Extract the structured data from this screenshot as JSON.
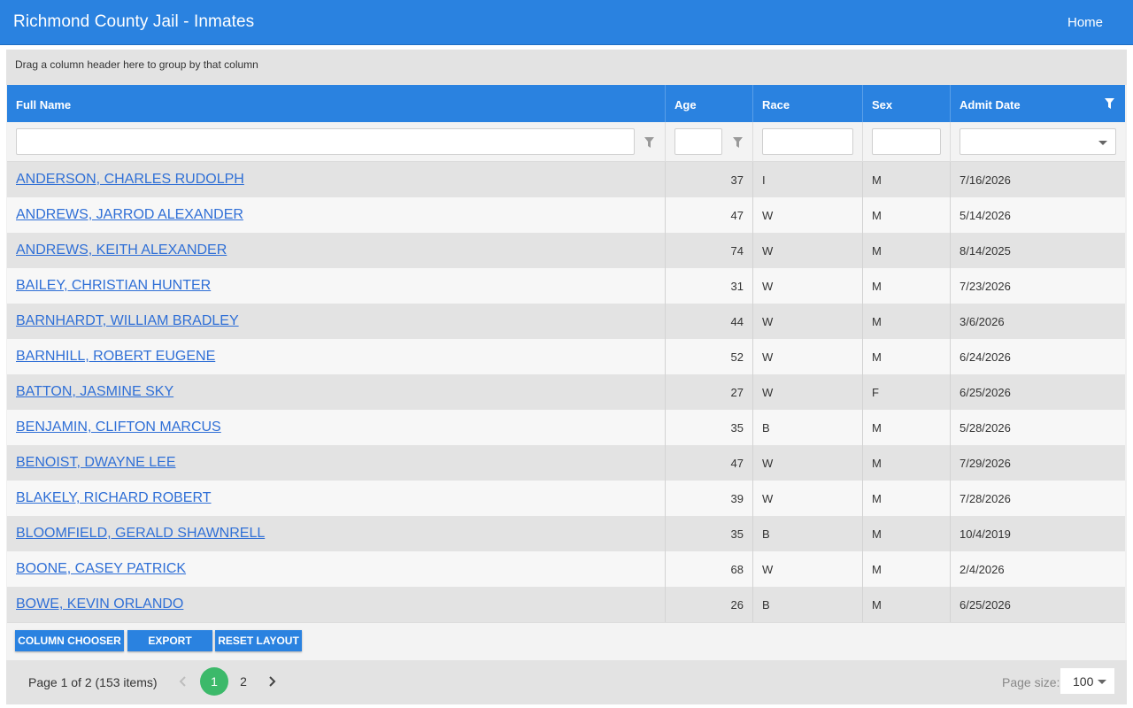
{
  "app": {
    "title": "Richmond County Jail - Inmates",
    "home_label": "Home"
  },
  "grid": {
    "group_panel_text": "Drag a column header here to group by that column",
    "columns": [
      "Full Name",
      "Age",
      "Race",
      "Sex",
      "Admit Date"
    ],
    "rows": [
      {
        "name": "ANDERSON, CHARLES RUDOLPH",
        "age": "37",
        "race": "I",
        "sex": "M",
        "admit": "7/16/2026"
      },
      {
        "name": "ANDREWS, JARROD ALEXANDER",
        "age": "47",
        "race": "W",
        "sex": "M",
        "admit": "5/14/2026"
      },
      {
        "name": "ANDREWS, KEITH ALEXANDER",
        "age": "74",
        "race": "W",
        "sex": "M",
        "admit": "8/14/2025"
      },
      {
        "name": "BAILEY, CHRISTIAN HUNTER",
        "age": "31",
        "race": "W",
        "sex": "M",
        "admit": "7/23/2026"
      },
      {
        "name": "BARNHARDT, WILLIAM BRADLEY",
        "age": "44",
        "race": "W",
        "sex": "M",
        "admit": "3/6/2026"
      },
      {
        "name": "BARNHILL, ROBERT EUGENE",
        "age": "52",
        "race": "W",
        "sex": "M",
        "admit": "6/24/2026"
      },
      {
        "name": "BATTON, JASMINE SKY",
        "age": "27",
        "race": "W",
        "sex": "F",
        "admit": "6/25/2026"
      },
      {
        "name": "BENJAMIN, CLIFTON MARCUS",
        "age": "35",
        "race": "B",
        "sex": "M",
        "admit": "5/28/2026"
      },
      {
        "name": "BENOIST, DWAYNE LEE",
        "age": "47",
        "race": "W",
        "sex": "M",
        "admit": "7/29/2026"
      },
      {
        "name": "BLAKELY, RICHARD ROBERT",
        "age": "39",
        "race": "W",
        "sex": "M",
        "admit": "7/28/2026"
      },
      {
        "name": "BLOOMFIELD, GERALD SHAWNRELL",
        "age": "35",
        "race": "B",
        "sex": "M",
        "admit": "10/4/2019"
      },
      {
        "name": "BOONE, CASEY PATRICK",
        "age": "68",
        "race": "W",
        "sex": "M",
        "admit": "2/4/2026"
      },
      {
        "name": "BOWE, KEVIN ORLANDO",
        "age": "26",
        "race": "B",
        "sex": "M",
        "admit": "6/25/2026"
      }
    ]
  },
  "toolbar": {
    "column_chooser": "COLUMN CHOOSER",
    "export": "EXPORT",
    "reset_layout": "RESET LAYOUT"
  },
  "pager": {
    "info": "Page 1 of 2 (153 items)",
    "pages": [
      "1",
      "2"
    ],
    "page_size_label": "Page size:",
    "page_size": "100"
  },
  "colors": {
    "header_blue": "#2a82e0",
    "link_blue": "#2f6fd6",
    "active_page_green": "#3cb96a"
  }
}
